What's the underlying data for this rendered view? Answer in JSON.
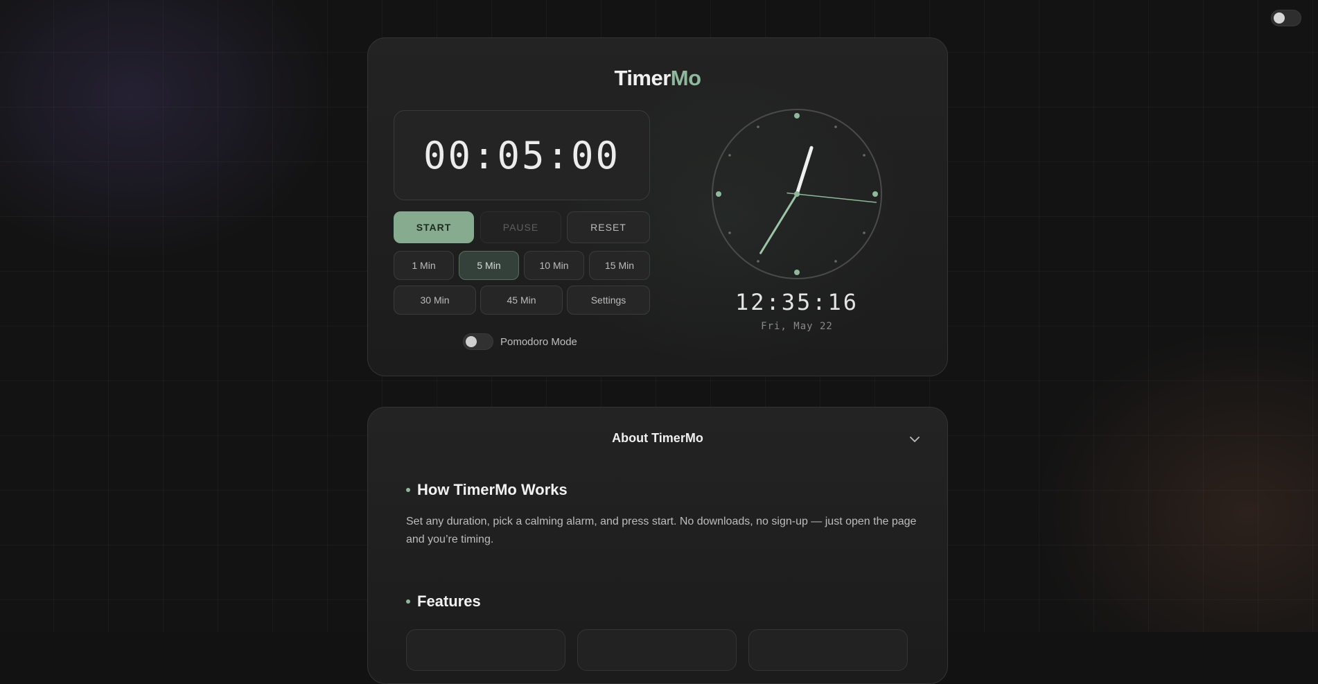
{
  "app": {
    "brand_part1": "Timer",
    "brand_part2": "Mo"
  },
  "timer": {
    "display": "00:05:00",
    "controls": {
      "start": "START",
      "pause": "PAUSE",
      "reset": "RESET"
    },
    "presets_row1": [
      "1 Min",
      "5 Min",
      "10 Min",
      "15 Min"
    ],
    "presets_row2": [
      "30 Min",
      "45 Min",
      "Settings"
    ],
    "active_preset": "5 Min",
    "pomodoro_label": "Pomodoro Mode",
    "pomodoro_enabled": false
  },
  "clock": {
    "digital": "12:35:16",
    "date": "Fri, May 22",
    "hours": 12,
    "minutes": 35,
    "seconds": 16,
    "hand_color": "#8fb89c"
  },
  "theme_toggle_enabled": false,
  "about": {
    "title": "About TimerMo",
    "section1_heading": "How TimerMo Works",
    "section1_text": "Set any duration, pick a calming alarm, and press start. No downloads, no sign-up — just open the page and you’re timing.",
    "section2_heading": "Features"
  },
  "colors": {
    "accent": "#86ab8f",
    "background": "#131313"
  }
}
